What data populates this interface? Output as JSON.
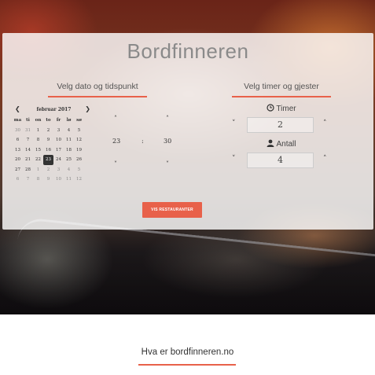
{
  "title": "Bordfinneren",
  "date_section": {
    "heading": "Velg dato og tidspunkt"
  },
  "guests_section": {
    "heading": "Velg timer og gjester"
  },
  "calendar": {
    "month_label": "februar 2017",
    "prev_icon": "chevron-left-icon",
    "next_icon": "chevron-right-icon",
    "weekdays": [
      "ma",
      "ti",
      "on",
      "to",
      "fr",
      "lø",
      "sø"
    ],
    "weeks": [
      [
        "30",
        "31",
        "1",
        "2",
        "3",
        "4",
        "5"
      ],
      [
        "6",
        "7",
        "8",
        "9",
        "10",
        "11",
        "12"
      ],
      [
        "13",
        "14",
        "15",
        "16",
        "17",
        "18",
        "19"
      ],
      [
        "20",
        "21",
        "22",
        "23",
        "24",
        "25",
        "26"
      ],
      [
        "27",
        "28",
        "1",
        "2",
        "3",
        "4",
        "5"
      ],
      [
        "6",
        "7",
        "8",
        "9",
        "10",
        "11",
        "12"
      ]
    ],
    "selected": "23"
  },
  "time_picker": {
    "hour": "23",
    "separator": ":",
    "minute": "30"
  },
  "hours": {
    "label": "Timer",
    "icon": "clock-icon",
    "value": "2"
  },
  "guests": {
    "label": "Antall",
    "icon": "user-icon",
    "value": "4"
  },
  "submit": {
    "label": "VIS RESTAURANTER"
  },
  "info": {
    "heading": "Hva er bordfinneren.no"
  },
  "colors": {
    "accent": "#e8614a",
    "selected_day": "#333333"
  }
}
